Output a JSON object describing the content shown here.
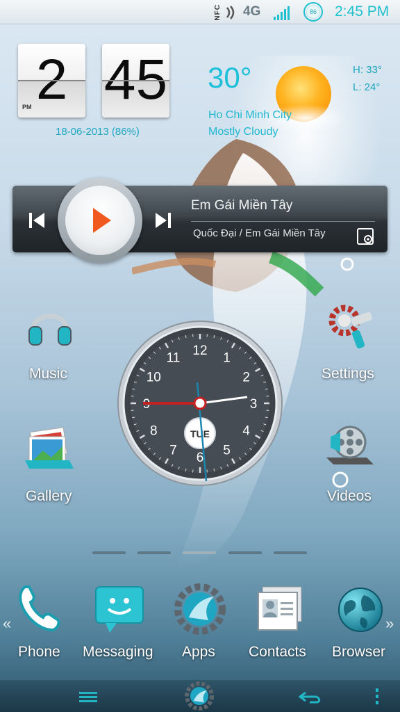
{
  "status_bar": {
    "nfc": "NFC",
    "network": "4G",
    "battery_percent": "86",
    "time": "2:45 PM"
  },
  "clock_widget": {
    "hour": "2",
    "minute": "45",
    "ampm": "PM",
    "date": "18-06-2013 (86%)"
  },
  "weather": {
    "temperature": "30°",
    "city": "Ho Chi Minh City",
    "condition": "Mostly Cloudy",
    "high": "H:  33°",
    "low": "L:  24°"
  },
  "music_player": {
    "title": "Em Gái Miền Tây",
    "artist": "Quốc Đại / Em Gái Miền Tây"
  },
  "home_apps": [
    {
      "label": "Music",
      "icon": "headphones-icon"
    },
    {
      "label": "Settings",
      "icon": "gear-icon"
    },
    {
      "label": "Gallery",
      "icon": "photos-icon"
    },
    {
      "label": "Videos",
      "icon": "film-reel-icon"
    }
  ],
  "analog_clock": {
    "day": "TUE",
    "numbers": [
      "12",
      "1",
      "2",
      "3",
      "4",
      "5",
      "6",
      "7",
      "8",
      "9",
      "10",
      "11"
    ]
  },
  "dock": {
    "apps": [
      {
        "label": "Phone",
        "icon": "phone-handset-icon"
      },
      {
        "label": "Messaging",
        "icon": "message-bubble-icon"
      },
      {
        "label": "Apps",
        "icon": "apps-gear-icon"
      },
      {
        "label": "Contacts",
        "icon": "contacts-card-icon"
      },
      {
        "label": "Browser",
        "icon": "globe-icon"
      }
    ],
    "left_arrow": "«",
    "right_arrow": "»"
  },
  "colors": {
    "accent": "#1fc1cf",
    "play_triangle": "#f05a1e"
  }
}
